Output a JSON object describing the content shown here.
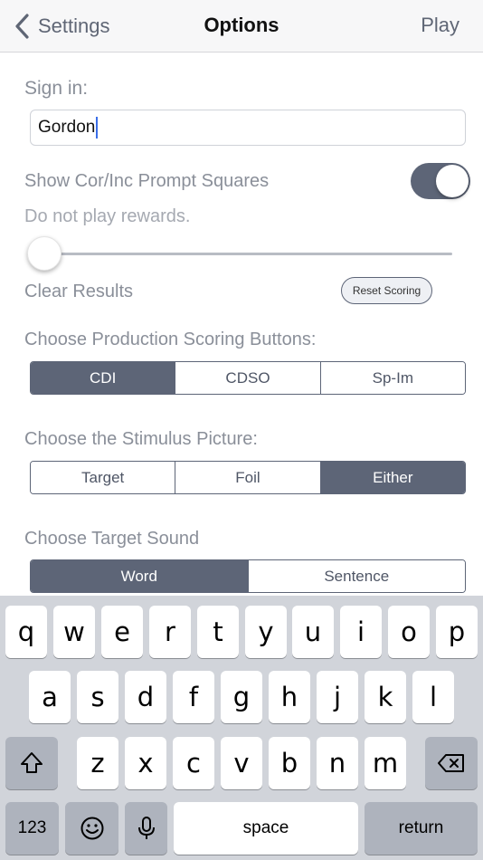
{
  "nav": {
    "back_label": "Settings",
    "title": "Options",
    "play_label": "Play"
  },
  "sign_in": {
    "label": "Sign in:",
    "value": "Gordon"
  },
  "prompt_squares": {
    "label": "Show Cor/Inc Prompt Squares",
    "enabled": true
  },
  "rewards": {
    "label": "Do not play rewards.",
    "slider_value": 0
  },
  "clear_results": {
    "label": "Clear Results",
    "button_label": "Reset Scoring"
  },
  "production_scoring": {
    "label": "Choose Production Scoring Buttons:",
    "options": [
      "CDI",
      "CDSO",
      "Sp-Im"
    ],
    "selected": "CDI"
  },
  "stimulus_picture": {
    "label": "Choose the Stimulus Picture:",
    "options": [
      "Target",
      "Foil",
      "Either"
    ],
    "selected": "Either"
  },
  "target_sound": {
    "label": "Choose Target Sound",
    "options": [
      "Word",
      "Sentence"
    ],
    "selected": "Word"
  },
  "keyboard": {
    "row1": [
      "q",
      "w",
      "e",
      "r",
      "t",
      "y",
      "u",
      "i",
      "o",
      "p"
    ],
    "row2": [
      "a",
      "s",
      "d",
      "f",
      "g",
      "h",
      "j",
      "k",
      "l"
    ],
    "row3": [
      "z",
      "x",
      "c",
      "v",
      "b",
      "n",
      "m"
    ],
    "numbers_label": "123",
    "space_label": "space",
    "return_label": "return"
  },
  "colors": {
    "accent": "#5d6577",
    "label_gray": "#8a8f99",
    "keyboard_bg": "#d1d4da"
  }
}
